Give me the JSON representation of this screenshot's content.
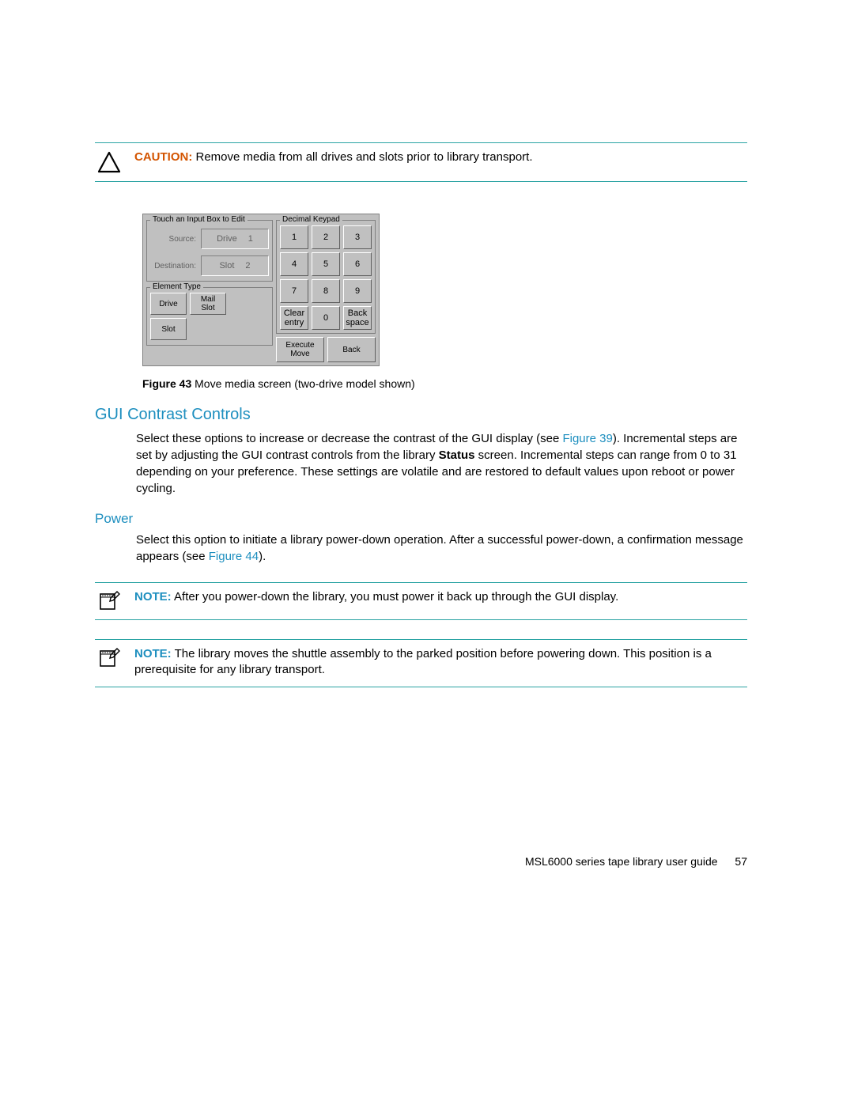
{
  "caution": {
    "label": "CAUTION:",
    "text": "Remove media from all drives and slots prior to library transport."
  },
  "gui": {
    "inputBoxLegend": "Touch an Input Box to Edit",
    "sourceLabel": "Source:",
    "sourceType": "Drive",
    "sourceNum": "1",
    "destLabel": "Destination:",
    "destType": "Slot",
    "destNum": "2",
    "elementTypeLegend": "Element Type",
    "btnDrive": "Drive",
    "btnMailSlot": "Mail\nSlot",
    "btnSlot": "Slot",
    "keypadLegend": "Decimal Keypad",
    "keys": [
      "1",
      "2",
      "3",
      "4",
      "5",
      "6",
      "7",
      "8",
      "9"
    ],
    "clearEntry": "Clear\nentry",
    "zero": "0",
    "backspace": "Back\nspace",
    "execute": "Execute\nMove",
    "back": "Back"
  },
  "figure43": {
    "label": "Figure 43",
    "caption": "Move media screen (two-drive model shown)"
  },
  "sectionGui": {
    "heading": "GUI Contrast Controls",
    "p1a": "Select these options to increase or decrease the contrast of the GUI display (see ",
    "linkFig39": "Figure 39",
    "p1b": "). Incremental steps are set by adjusting the GUI contrast controls from the library ",
    "statusWord": "Status",
    "p1c": " screen. Incremental steps can range from 0 to 31 depending on your preference. These settings are volatile and are restored to default values upon reboot or power cycling."
  },
  "sectionPower": {
    "heading": "Power",
    "p1a": "Select this option to initiate a library power-down operation. After a successful power-down, a confirmation message appears (see ",
    "linkFig44": "Figure 44",
    "p1b": ")."
  },
  "note1": {
    "label": "NOTE:",
    "text": "After you power-down the library, you must power it back up through the GUI display."
  },
  "note2": {
    "label": "NOTE:",
    "text": "The library moves the shuttle assembly to the parked position before powering down. This position is a prerequisite for any library transport."
  },
  "footer": {
    "title": "MSL6000 series tape library user guide",
    "page": "57"
  }
}
